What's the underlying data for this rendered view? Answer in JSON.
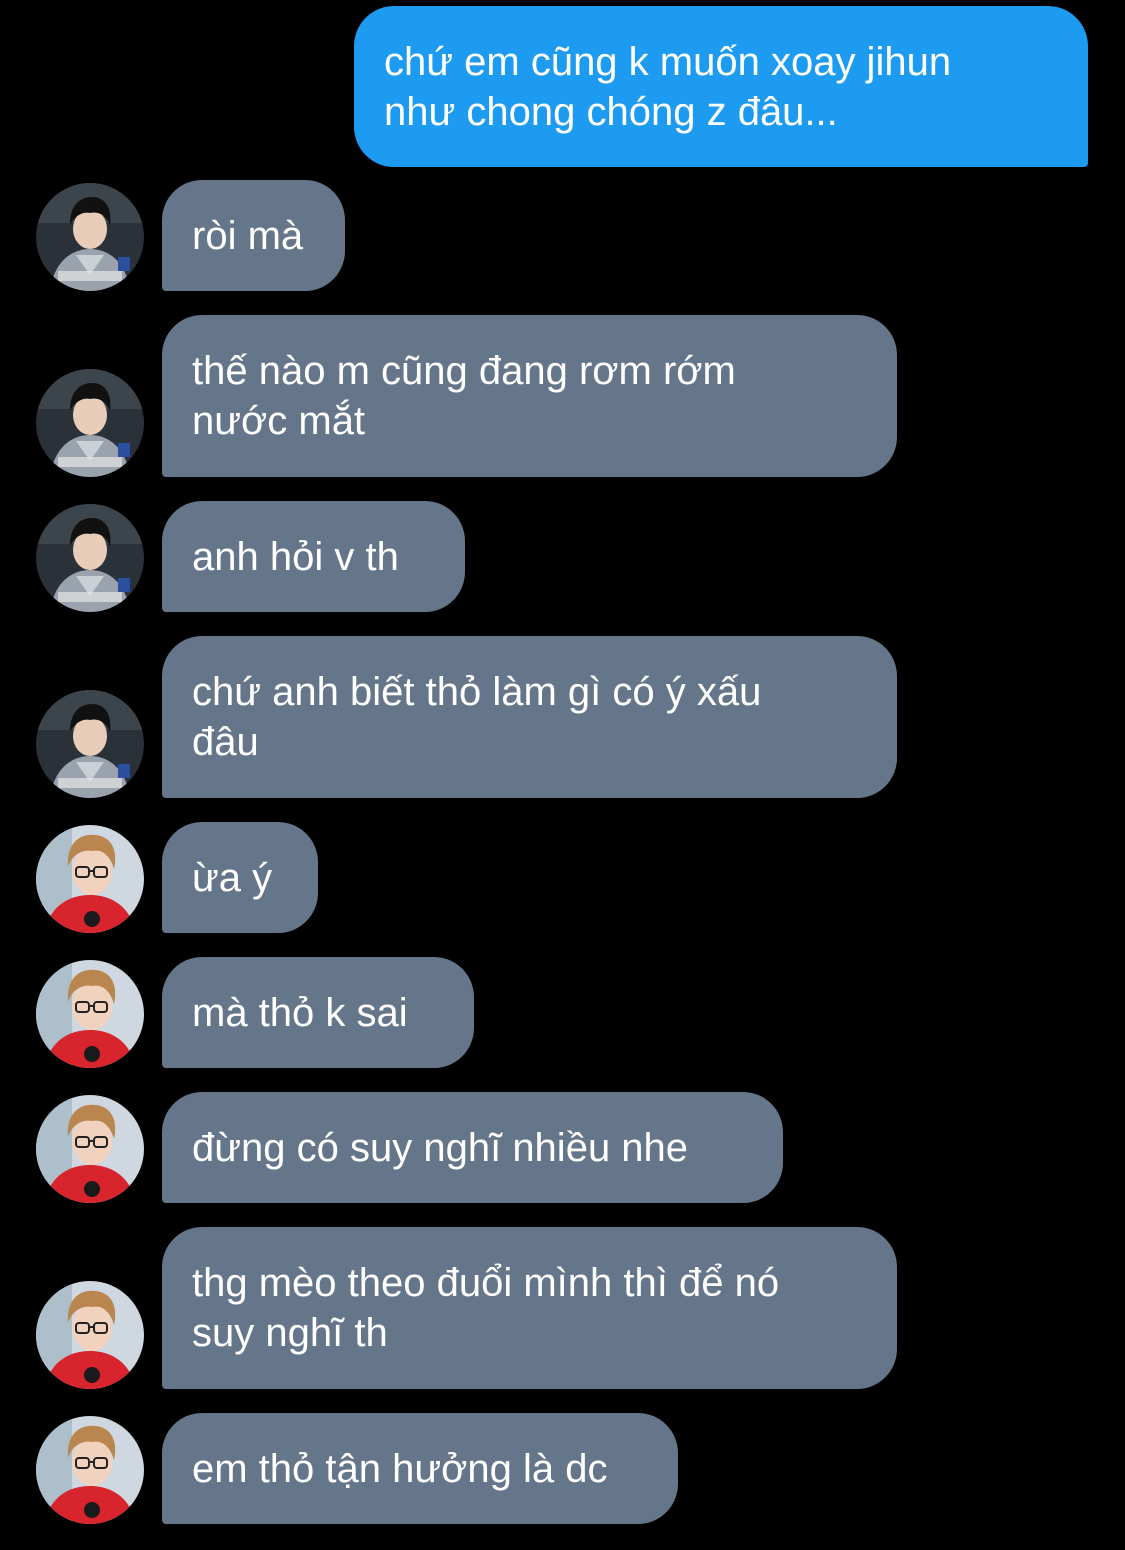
{
  "colors": {
    "background": "#000000",
    "outgoing_bubble": "#1d9bf0",
    "incoming_bubble": "#66768a",
    "text": "#ffffff"
  },
  "messages": [
    {
      "side": "outgoing",
      "text": "chứ em cũng k muốn xoay jihun\nnhư chong chóng z đâu..."
    },
    {
      "side": "incoming",
      "sender_icon": "avatar-dark-hair-gray-hoodie",
      "text": "ròi mà"
    },
    {
      "side": "incoming",
      "sender_icon": "avatar-dark-hair-gray-hoodie",
      "text": "thế nào m cũng đang rơm rớm\nnước mắt"
    },
    {
      "side": "incoming",
      "sender_icon": "avatar-dark-hair-gray-hoodie",
      "text": "anh hỏi v th"
    },
    {
      "side": "incoming",
      "sender_icon": "avatar-dark-hair-gray-hoodie",
      "text": "chứ anh biết thỏ làm gì có ý xấu\nđâu"
    },
    {
      "side": "incoming",
      "sender_icon": "avatar-glasses-red-jersey",
      "text": "ừa ý"
    },
    {
      "side": "incoming",
      "sender_icon": "avatar-glasses-red-jersey",
      "text": "mà thỏ k sai"
    },
    {
      "side": "incoming",
      "sender_icon": "avatar-glasses-red-jersey",
      "text": "đừng có suy nghĩ nhiều nhe"
    },
    {
      "side": "incoming",
      "sender_icon": "avatar-glasses-red-jersey",
      "text": "thg mèo theo đuổi mình thì để nó\nsuy nghĩ th"
    },
    {
      "side": "incoming",
      "sender_icon": "avatar-glasses-red-jersey",
      "text": "em thỏ tận hưởng là dc"
    }
  ]
}
